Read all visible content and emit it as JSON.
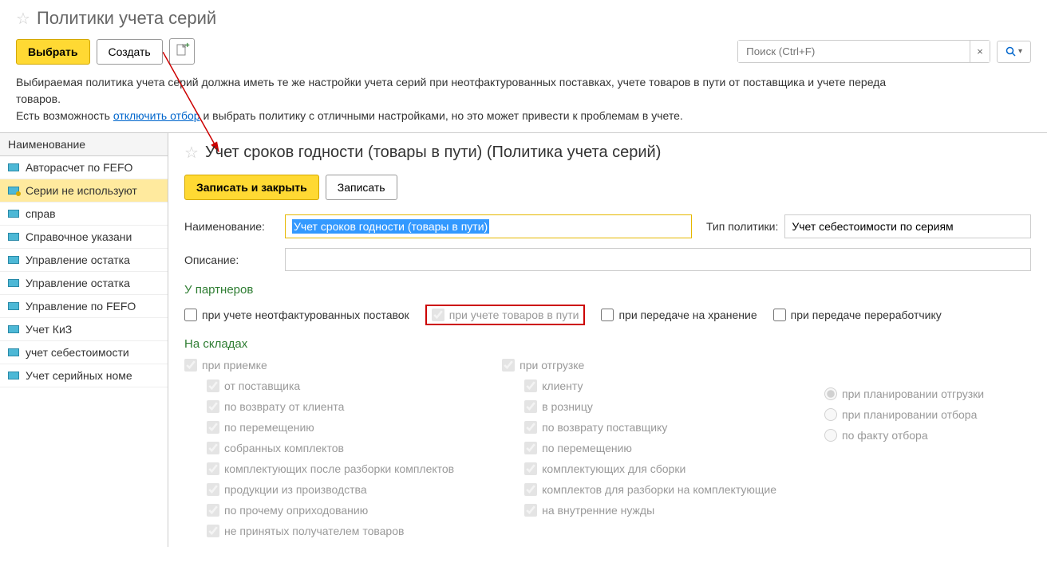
{
  "header": {
    "title": "Политики учета серий"
  },
  "toolbar": {
    "select": "Выбрать",
    "create": "Создать",
    "search_placeholder": "Поиск (Ctrl+F)"
  },
  "info": {
    "line1": "Выбираемая политика учета серий должна иметь те же настройки учета серий при неотфактурованных поставках, учете товаров в пути от поставщика и учете переда",
    "line2_prefix": "товаров.",
    "line3_prefix": "Есть возможность ",
    "line3_link": "отключить отбор",
    "line3_suffix": " и выбрать политику с отличными настройками, но это может привести к проблемам в учете."
  },
  "sidebar": {
    "column": "Наименование",
    "items": [
      "Авторасчет по FEFO",
      "Серии не используют",
      "справ",
      "Справочное указани",
      "Управление остатка",
      "Управление остатка",
      "Управление по FEFO",
      "Учет КиЗ",
      "учет себестоимости",
      "Учет серийных номе"
    ]
  },
  "form": {
    "title": "Учет сроков годности (товары в пути) (Политика учета серий)",
    "save_close": "Записать и закрыть",
    "save": "Записать",
    "name_label": "Наименование:",
    "name_value": "Учет сроков годности (товары в пути)",
    "policy_type_label": "Тип политики:",
    "policy_type_value": "Учет себестоимости по сериям",
    "description_label": "Описание:",
    "partners_title": "У партнеров",
    "partners": {
      "cb1": "при учете неотфактурованных поставок",
      "cb2": "при учете товаров в пути",
      "cb3": "при передаче на хранение",
      "cb4": "при передаче переработчику"
    },
    "warehouses_title": "На складах",
    "warehouses": {
      "receive": "при приемке",
      "ship": "при отгрузке",
      "r1": "от поставщика",
      "r2": "по возврату от клиента",
      "r3": "по перемещению",
      "r4": "собранных комплектов",
      "r5": "комплектующих после разборки комплектов",
      "r6": "продукции из производства",
      "r7": "по прочему оприходованию",
      "r8": "не принятых получателем товаров",
      "s1": "клиенту",
      "s2": "в розницу",
      "s3": "по возврату поставщику",
      "s4": "по перемещению",
      "s5": "комплектующих для сборки",
      "s6": "комплектов для разборки на комплектующие",
      "s7": "на внутренние нужды",
      "rad1": "при планировании отгрузки",
      "rad2": "при планировании отбора",
      "rad3": "по факту отбора"
    }
  }
}
